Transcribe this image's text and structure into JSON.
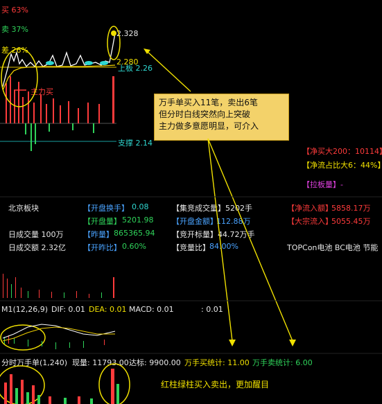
{
  "buy_sell_pct": {
    "buy": "买 63%",
    "sell": "卖 37%",
    "diff": "差 26%"
  },
  "price_labels": {
    "high": "2.328",
    "current": "2.280",
    "resistance": "上板 2.26",
    "support": "支撑 2.14",
    "main_buy": "主力买"
  },
  "callout": {
    "line1": "万手单买入11笔，卖出6笔",
    "line2": "但分时白线突然向上突破",
    "line3": "主力做多意愿明显，可介入"
  },
  "right_panel": {
    "net_buy_200": "【净买大200：10114】",
    "net_flow_big6": "【净流占比大6：44%】",
    "limit_up": "【拉板量】-"
  },
  "stats": {
    "sector": "北京板块",
    "open_turnover_label": "【开盘换手】",
    "open_turnover": "0.08",
    "open_volume_label": "【开盘量】",
    "open_volume": "5201.98",
    "yday_volume_label": "【昨量】",
    "yday_volume": "865365.94",
    "open_ratio_label": "【开昨比】",
    "open_ratio": "0.60%",
    "auction_volume": "【集竞成交量】5202手",
    "open_amount_label": "【开盘金额】",
    "open_amount": "112.88万",
    "bid_amount": "【竞开标量】44.72万手",
    "bid_ratio_label": "【竞量比】",
    "bid_ratio": "84.00%",
    "net_inflow_label": "【净流入额】",
    "net_inflow": "5858.17万",
    "block_inflow_label": "【大宗流入】",
    "block_inflow": "5055.45万",
    "day_volume": "日成交量  100万",
    "day_amount": "日成交额  2.32亿",
    "concepts": "TOPCon电池 BC电池 节能"
  },
  "macd": {
    "title": "M1(12,26,9)",
    "dif": "DIF: 0.01",
    "dea": "DEA: 0.01",
    "macd": "MACD: 0.01",
    "extra": ": 0.01"
  },
  "bottom": {
    "title": "分时万手单(1,240)",
    "current_label": "现量: 11793.00",
    "threshold_label": "达标: 9900.00",
    "buy_count": "万手买统计: 11.00",
    "sell_count": "万手卖统计: 6.00",
    "note": "红柱绿柱买入卖出，更加醒目"
  },
  "colors": {
    "up": "#ff3b3b",
    "down": "#2fd35a",
    "annotation": "#f0e000",
    "callout_bg": "#f3d26a"
  }
}
